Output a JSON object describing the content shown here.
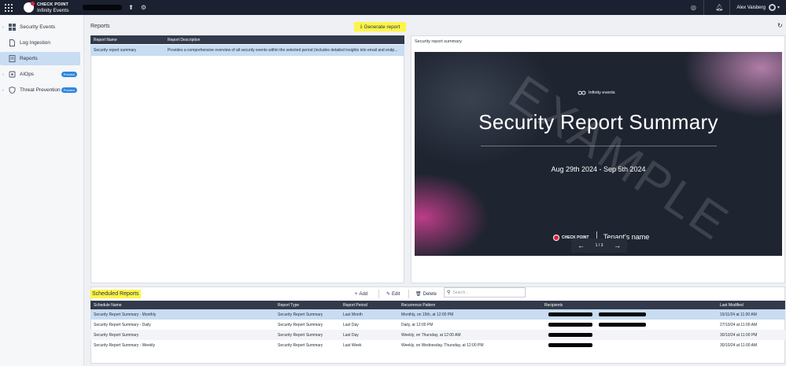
{
  "header": {
    "brand_name": "CHECK POINT",
    "product_name": "Infinity Events",
    "user_name": "Alex Vaisberg",
    "icons": [
      "grid-icon",
      "upload-icon",
      "settings-icon",
      "lifebuoy-icon",
      "bell-icon",
      "user-avatar-icon",
      "chevron-down-icon"
    ]
  },
  "sidebar": {
    "items": [
      {
        "label": "Security Events",
        "icon": "dashboard-icon",
        "active": false,
        "badge": ""
      },
      {
        "label": "Log Ingestion",
        "icon": "file-icon",
        "active": false,
        "badge": ""
      },
      {
        "label": "Reports",
        "icon": "report-icon",
        "active": true,
        "badge": ""
      },
      {
        "label": "AIOps",
        "icon": "ai-icon",
        "active": false,
        "badge": "Preview"
      },
      {
        "label": "Threat Prevention",
        "icon": "shield-icon",
        "active": false,
        "badge": "Preview"
      }
    ]
  },
  "reports": {
    "title": "Reports",
    "generate_label": "Generate report",
    "columns": [
      "Report Name",
      "Report Description"
    ],
    "rows": [
      {
        "name": "Security report summary",
        "description": "Provides a comprehensive overview of all security events within the selected period (includes detailed insights into email and endp..."
      }
    ]
  },
  "preview": {
    "title": "Security report summary",
    "watermark": "EXAMPLE",
    "logo_text": "Infinity events",
    "heading": "Security Report Summary",
    "date_range": "Aug 29th 2024 - Sep 5th 2024",
    "brand": "CHECK POINT",
    "tenant": "Tenant's name",
    "page_indicator": "1 / 3",
    "prev_arrow": "←",
    "next_arrow": "→"
  },
  "scheduled": {
    "title": "Scheduled Reports",
    "add_label": "Add",
    "edit_label": "Edit",
    "delete_label": "Delete",
    "search_placeholder": "Search...",
    "columns": [
      "Schedule Name",
      "Report Type",
      "Report Period",
      "Recurrence Pattern",
      "Recipients",
      "Last Modified"
    ],
    "rows": [
      {
        "name": "Security Report Summary - Monthly",
        "type": "Security Report Summary",
        "period": "Last Month",
        "recurrence": "Monthly, on 15th, at 12:00 PM",
        "modified": "15/11/24 at 11:00 AM"
      },
      {
        "name": "Security Report Summary - Daily",
        "type": "Security Report Summary",
        "period": "Last Day",
        "recurrence": "Daily, at 12:00 PM",
        "modified": "27/10/24 at 11:00 AM"
      },
      {
        "name": "Security Report Summary",
        "type": "Security Report Summary",
        "period": "Last Day",
        "recurrence": "Weekly, on Thursday, at 12:00 AM",
        "modified": "30/10/24 at 11:00 PM"
      },
      {
        "name": "Security Report Summary - Weekly",
        "type": "Security Report Summary",
        "period": "Last Week",
        "recurrence": "Weekly, on Wednesday, Thursday, at 12:00 PM",
        "modified": "30/10/24 at 11:00 AM"
      }
    ]
  }
}
